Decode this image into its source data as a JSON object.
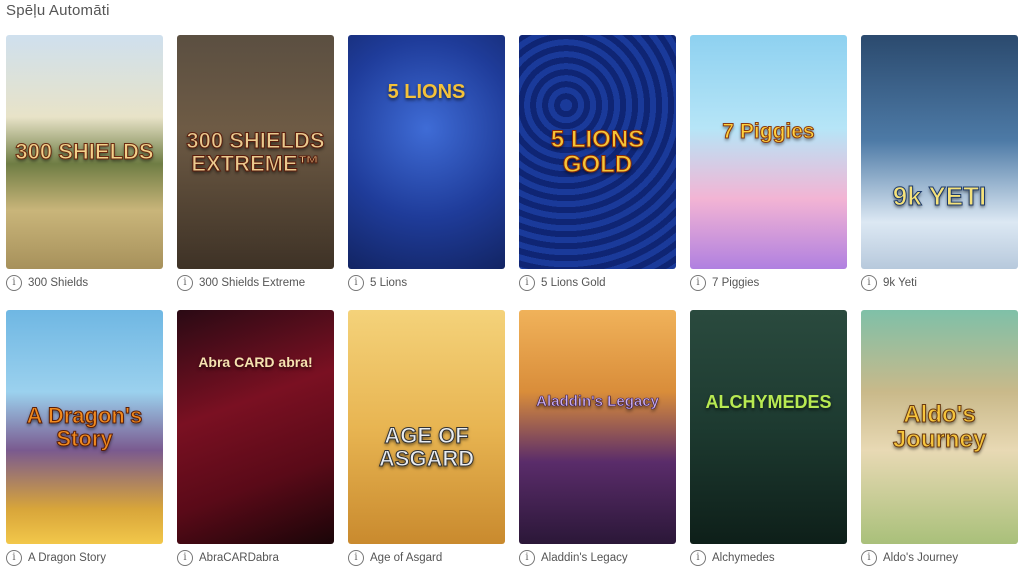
{
  "section": {
    "title": "Spēļu Automāti"
  },
  "games": [
    {
      "title": "300 Shields",
      "thumb_text": "300 SHIELDS",
      "thumb_class": "t0"
    },
    {
      "title": "300 Shields Extreme",
      "thumb_text": "300 SHIELDS EXTREME™",
      "thumb_class": "t1"
    },
    {
      "title": "5 Lions",
      "thumb_text": "5 LIONS",
      "thumb_class": "t2"
    },
    {
      "title": "5 Lions Gold",
      "thumb_text": "5 LIONS GOLD",
      "thumb_class": "t3"
    },
    {
      "title": "7 Piggies",
      "thumb_text": "7 Piggies",
      "thumb_class": "t4"
    },
    {
      "title": "9k Yeti",
      "thumb_text": "9k YETI",
      "thumb_class": "t5"
    },
    {
      "title": "A Dragon Story",
      "thumb_text": "A Dragon's Story",
      "thumb_class": "t6"
    },
    {
      "title": "AbraCARDabra",
      "thumb_text": "Abra CARD abra!",
      "thumb_class": "t7"
    },
    {
      "title": "Age of Asgard",
      "thumb_text": "AGE OF ASGARD",
      "thumb_class": "t8"
    },
    {
      "title": "Aladdin's Legacy",
      "thumb_text": "Aladdin's Legacy",
      "thumb_class": "t9"
    },
    {
      "title": "Alchymedes",
      "thumb_text": "ALCHYMEDES",
      "thumb_class": "t10"
    },
    {
      "title": "Aldo's Journey",
      "thumb_text": "Aldo's Journey",
      "thumb_class": "t11"
    }
  ],
  "info_icon": "info-icon",
  "info_glyph": "i"
}
